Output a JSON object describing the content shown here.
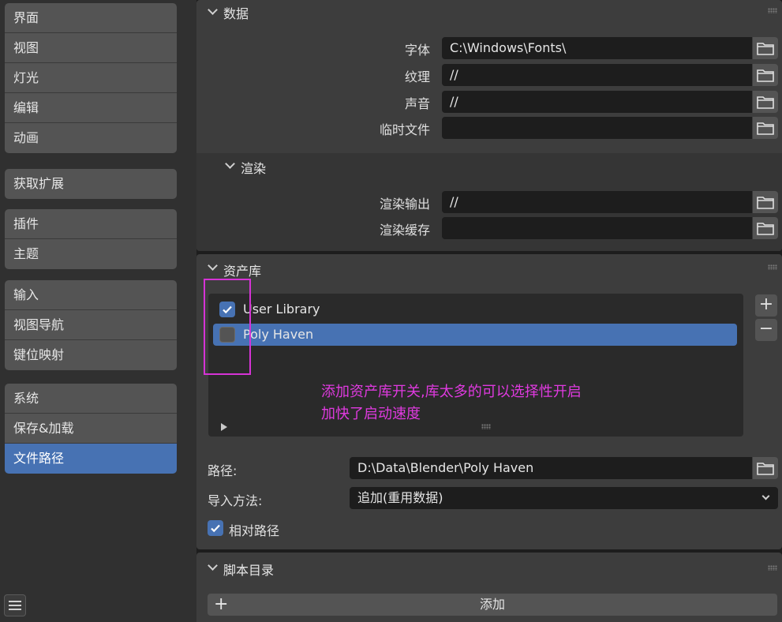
{
  "sidebar": {
    "groups": [
      [
        "界面",
        "视图",
        "灯光",
        "编辑",
        "动画"
      ],
      [
        "获取扩展"
      ],
      [
        "插件",
        "主题"
      ],
      [
        "输入",
        "视图导航",
        "键位映射"
      ],
      [
        "系统",
        "保存&加载",
        "文件路径"
      ]
    ],
    "active": "文件路径"
  },
  "data_panel": {
    "title": "数据",
    "rows": [
      {
        "label": "字体",
        "value": "C:\\Windows\\Fonts\\"
      },
      {
        "label": "纹理",
        "value": "//"
      },
      {
        "label": "声音",
        "value": "//"
      },
      {
        "label": "临时文件",
        "value": ""
      }
    ],
    "render": {
      "title": "渲染",
      "rows": [
        {
          "label": "渲染输出",
          "value": "//"
        },
        {
          "label": "渲染缓存",
          "value": ""
        }
      ]
    }
  },
  "asset_panel": {
    "title": "资产库",
    "libraries": [
      {
        "name": "User Library",
        "enabled": true,
        "selected": false
      },
      {
        "name": "Poly Haven",
        "enabled": false,
        "selected": true
      }
    ],
    "add_symbol": "+",
    "remove_symbol": "−",
    "annotation": [
      "添加资产库开关,库太多的可以选择性开启",
      "加快了启动速度"
    ],
    "annotation_color": "#e03ae0",
    "path_label": "路径:",
    "path_value": "D:\\Data\\Blender\\Poly Haven",
    "import_label": "导入方法:",
    "import_value": "追加(重用数据)",
    "relative_label": "相对路径",
    "relative_checked": true
  },
  "script_panel": {
    "title": "脚本目录",
    "add_symbol": "+",
    "add_label": "添加"
  },
  "colors": {
    "accent": "#4772b3",
    "panel": "#3d3d3d",
    "field": "#1d1d1d"
  }
}
